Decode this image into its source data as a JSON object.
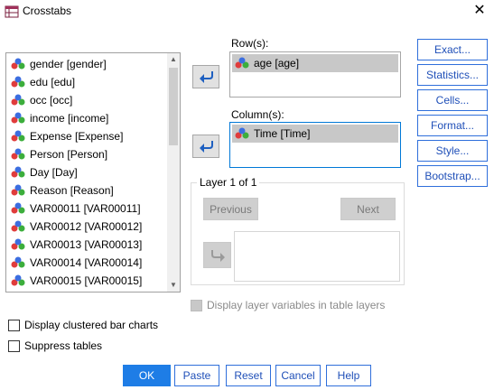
{
  "window": {
    "title": "Crosstabs",
    "close_label": "✕"
  },
  "variables": [
    "gender [gender]",
    "edu [edu]",
    "occ [occ]",
    "income [income]",
    "Expense [Expense]",
    "Person [Person]",
    "Day [Day]",
    "Reason [Reason]",
    "VAR00011 [VAR00011]",
    "VAR00012 [VAR00012]",
    "VAR00013 [VAR00013]",
    "VAR00014 [VAR00014]",
    "VAR00015 [VAR00015]"
  ],
  "rows": {
    "label": "Row(s):",
    "items": [
      "age [age]"
    ]
  },
  "columns": {
    "label": "Column(s):",
    "items": [
      "Time [Time]"
    ]
  },
  "layer": {
    "label": "Layer 1 of 1",
    "previous_label": "Previous",
    "next_label": "Next"
  },
  "options": {
    "display_layer": "Display layer variables in table layers",
    "clustered_bar": "Display clustered bar charts",
    "suppress_tables": "Suppress tables"
  },
  "side_buttons": [
    "Exact...",
    "Statistics...",
    "Cells...",
    "Format...",
    "Style...",
    "Bootstrap..."
  ],
  "bottom_buttons": [
    "OK",
    "Paste",
    "Reset",
    "Cancel",
    "Help"
  ],
  "colors": {
    "accent": "#1e7de6",
    "button_text": "#1f4fb8",
    "selection": "#c8c8c8"
  },
  "icons": {
    "variable": "nominal-variable-icon",
    "move": "arrow-right-icon"
  }
}
